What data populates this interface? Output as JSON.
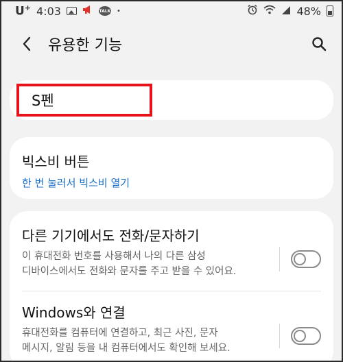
{
  "status_bar": {
    "carrier": "U",
    "carrier_plus": "+",
    "time": "4:03",
    "notification_dot": "•",
    "talk_label": "TALK",
    "battery": "48%"
  },
  "header": {
    "title": "유용한 기능"
  },
  "items": {
    "spen": {
      "title": "S펜"
    },
    "bixby": {
      "title": "빅스비 버튼",
      "subtitle": "한 번 눌러서 빅스비 열기"
    },
    "call_text": {
      "title": "다른 기기에서도 전화/문자하기",
      "desc_line1": "이 휴대전화 번호를 사용해서 나의 다른 삼성",
      "desc_line2": "디바이스에서도 전화와 문자를 주고 받을 수 있어요.",
      "toggle_on": false
    },
    "windows": {
      "title": "Windows와 연결",
      "desc_line1": "휴대전화를 컴퓨터에 연결하고, 최근 사진, 문자",
      "desc_line2": "메시지, 알림 등을 내 컴퓨터에서도 확인해 보세요.",
      "toggle_on": false
    }
  },
  "colors": {
    "background": "#f2f2f2",
    "card": "#ffffff",
    "link_blue": "#1a6fc9",
    "highlight_red": "#e8121b"
  },
  "icons": [
    "image-icon",
    "megaphone-icon",
    "talk-icon",
    "alarm-icon",
    "wifi-icon",
    "battery-icon",
    "back-icon",
    "search-icon"
  ]
}
